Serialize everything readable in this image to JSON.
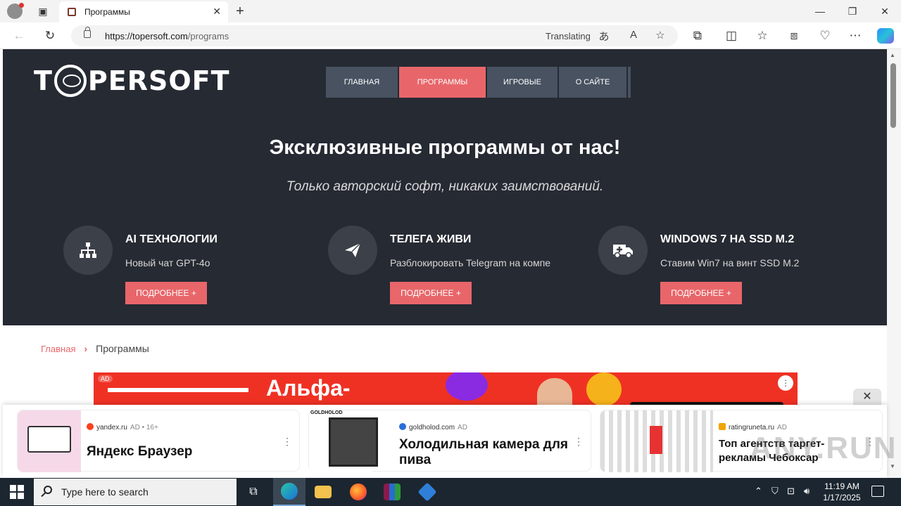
{
  "browser": {
    "tab_title": "Программы",
    "url_host": "https://topersoft.com",
    "url_path": "/programs",
    "translating_label": "Translating"
  },
  "site": {
    "logo": "TOPERSOFT",
    "nav": [
      {
        "label": "ГЛАВНАЯ",
        "active": false
      },
      {
        "label": "ПРОГРАММЫ",
        "active": true
      },
      {
        "label": "ИГРОВЫЕ",
        "active": false
      },
      {
        "label": "О САЙТЕ",
        "active": false
      }
    ],
    "hero_title": "Эксклюзивные программы от нас!",
    "hero_subtitle": "Только авторский софт, никаких заимствований.",
    "features": [
      {
        "icon": "sitemap-icon",
        "title": "AI ТЕХНОЛОГИИ",
        "desc": "Новый чат GPT-4o",
        "button": "ПОДРОБНЕЕ +"
      },
      {
        "icon": "paper-plane-icon",
        "title": "ТЕЛЕГА ЖИВИ",
        "desc": "Разблокировать Telegram на компе",
        "button": "ПОДРОБНЕЕ +"
      },
      {
        "icon": "ambulance-icon",
        "title": "WINDOWS 7 НА SSD M.2",
        "desc": "Ставим Win7 на винт SSD M.2",
        "button": "ПОДРОБНЕЕ +"
      }
    ],
    "breadcrumb": {
      "home": "Главная",
      "current": "Программы"
    },
    "banner": {
      "ad_label": "AD",
      "text": "Альфа-"
    }
  },
  "ads": [
    {
      "source": "yandex.ru",
      "tag": "AD • 16+",
      "title": "Яндекс Браузер"
    },
    {
      "source": "goldholod.com",
      "tag": "AD",
      "title": "Холодильная камера для пива",
      "thumb_label": "GOLDHOLOD"
    },
    {
      "source": "ratingruneta.ru",
      "tag": "AD",
      "title": "Топ агентств таргет-рекламы Чебоксар"
    }
  ],
  "watermark": "ANY.RUN",
  "taskbar": {
    "search_placeholder": "Type here to search",
    "time": "11:19 AM",
    "date": "1/17/2025"
  }
}
